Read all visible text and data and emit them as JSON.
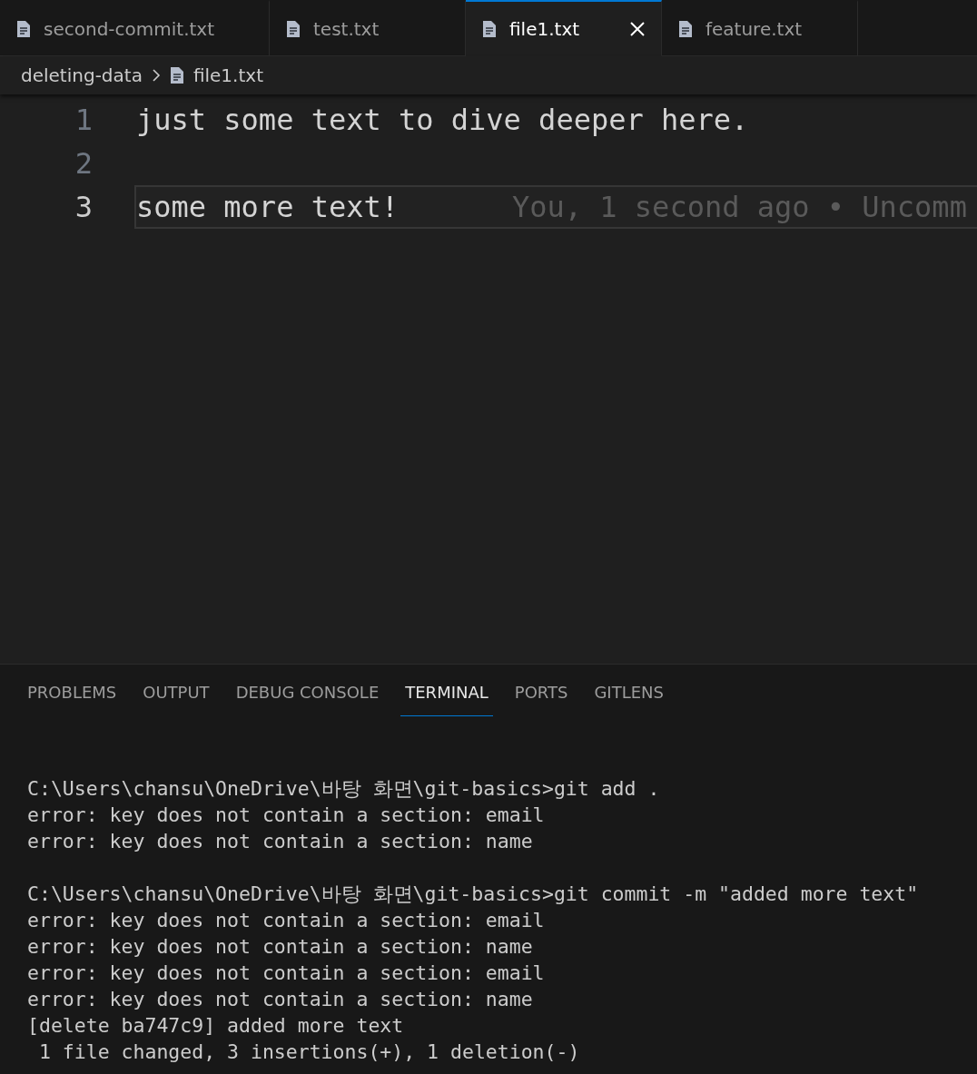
{
  "tabs": [
    {
      "label": "second-commit.txt",
      "selected": false
    },
    {
      "label": "test.txt",
      "selected": false
    },
    {
      "label": "file1.txt",
      "selected": true
    },
    {
      "label": "feature.txt",
      "selected": false
    }
  ],
  "breadcrumb": [
    {
      "kind": "folder",
      "label": "deleting-data"
    },
    {
      "kind": "file",
      "label": "file1.txt"
    }
  ],
  "editor": {
    "lines": [
      {
        "number": "1",
        "text": "just some text to dive deeper here.",
        "current": false
      },
      {
        "number": "2",
        "current": false
      },
      {
        "number": "3",
        "text": "some more text!",
        "current": true,
        "blame": "You, 1 second ago • Uncomm"
      }
    ]
  },
  "panel": {
    "tabs": [
      {
        "label": "PROBLEMS",
        "selected": false
      },
      {
        "label": "OUTPUT",
        "selected": false
      },
      {
        "label": "DEBUG CONSOLE",
        "selected": false
      },
      {
        "label": "TERMINAL",
        "selected": true
      },
      {
        "label": "PORTS",
        "selected": false
      },
      {
        "label": "GITLENS",
        "selected": false
      }
    ],
    "terminal": [
      [
        "C:\\Users\\chansu\\OneDrive\\바탕 화면\\git-basics>git add .",
        "error: key does not contain a section: email",
        "error: key does not contain a section: name"
      ],
      [
        "C:\\Users\\chansu\\OneDrive\\바탕 화면\\git-basics>git commit -m \"added more text\"",
        "error: key does not contain a section: email",
        "error: key does not contain a section: name",
        "error: key does not contain a section: email",
        "error: key does not contain a section: name",
        "[delete ba747c9] added more text",
        " 1 file changed, 3 insertions(+), 1 deletion(-)"
      ]
    ]
  }
}
